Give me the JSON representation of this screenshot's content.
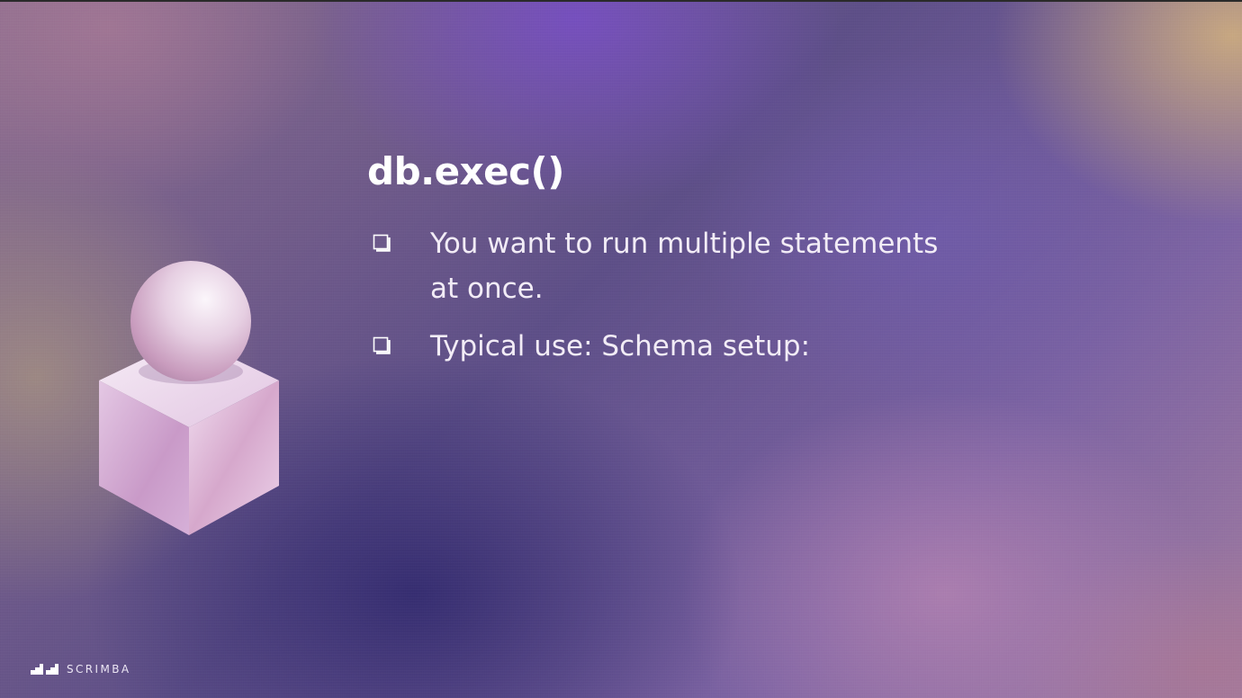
{
  "slide": {
    "title": "db.exec()",
    "bullets": [
      {
        "icon": "checkbox-icon",
        "text": "You want to run multiple statements at once."
      },
      {
        "icon": "checkbox-icon",
        "text": "Typical use: Schema setup:"
      }
    ],
    "illustration": {
      "icon": "sphere-on-cube-icon"
    }
  },
  "branding": {
    "logo_icon": "scrimba-logo-icon",
    "name": "SCRIMBA"
  },
  "colors": {
    "title": "#ffffff",
    "text": "#f2ecf6",
    "accent_purple": "#6e4fb4",
    "accent_gold": "#cdac80"
  }
}
